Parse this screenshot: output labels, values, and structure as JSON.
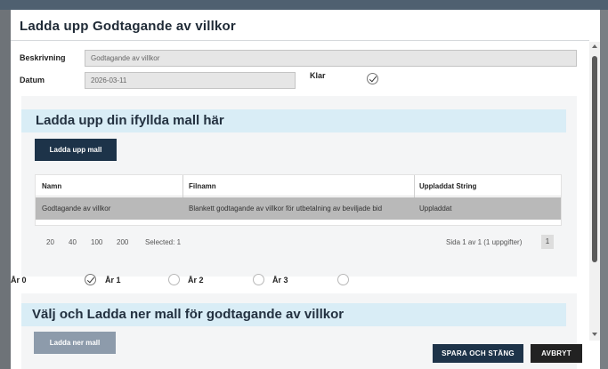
{
  "dialog": {
    "title": "Ladda upp Godtagande av villkor"
  },
  "form": {
    "beskrivning_label": "Beskrivning",
    "beskrivning_value": "Godtagande av villkor",
    "datum_label": "Datum",
    "datum_value": "2026-03-11",
    "klar_label": "Klar",
    "klar_checked": true
  },
  "upload_section": {
    "heading": "Ladda upp din ifyllda mall här",
    "upload_button": "Ladda upp mall",
    "table": {
      "columns": [
        "Namn",
        "Filnamn",
        "Uppladdat String"
      ],
      "rows": [
        [
          "Godtagande av villkor",
          "Blankett godtagande av villkor för utbetalning av beviljade bid",
          "Uppladdat"
        ]
      ]
    },
    "pager": {
      "sizes": [
        "20",
        "40",
        "100",
        "200"
      ],
      "selected_text": "Selected: 1",
      "page_info": "Sida 1 av 1 (1 uppgifter)",
      "current_page": "1"
    }
  },
  "years": {
    "items": [
      {
        "label": "År 0",
        "checked": true
      },
      {
        "label": "År 1",
        "checked": false
      },
      {
        "label": "År 2",
        "checked": false
      },
      {
        "label": "År 3",
        "checked": false
      }
    ]
  },
  "download_section": {
    "heading": "Välj och Ladda ner mall för godtagande av villkor",
    "download_button": "Ladda ner mall"
  },
  "footer": {
    "save_label": "SPARA OCH STÄNG",
    "cancel_label": "AVBRYT"
  },
  "colors": {
    "primary": "#1d3349",
    "section_header_bg": "#d9edf6",
    "selected_row": "#b9b9b9"
  }
}
